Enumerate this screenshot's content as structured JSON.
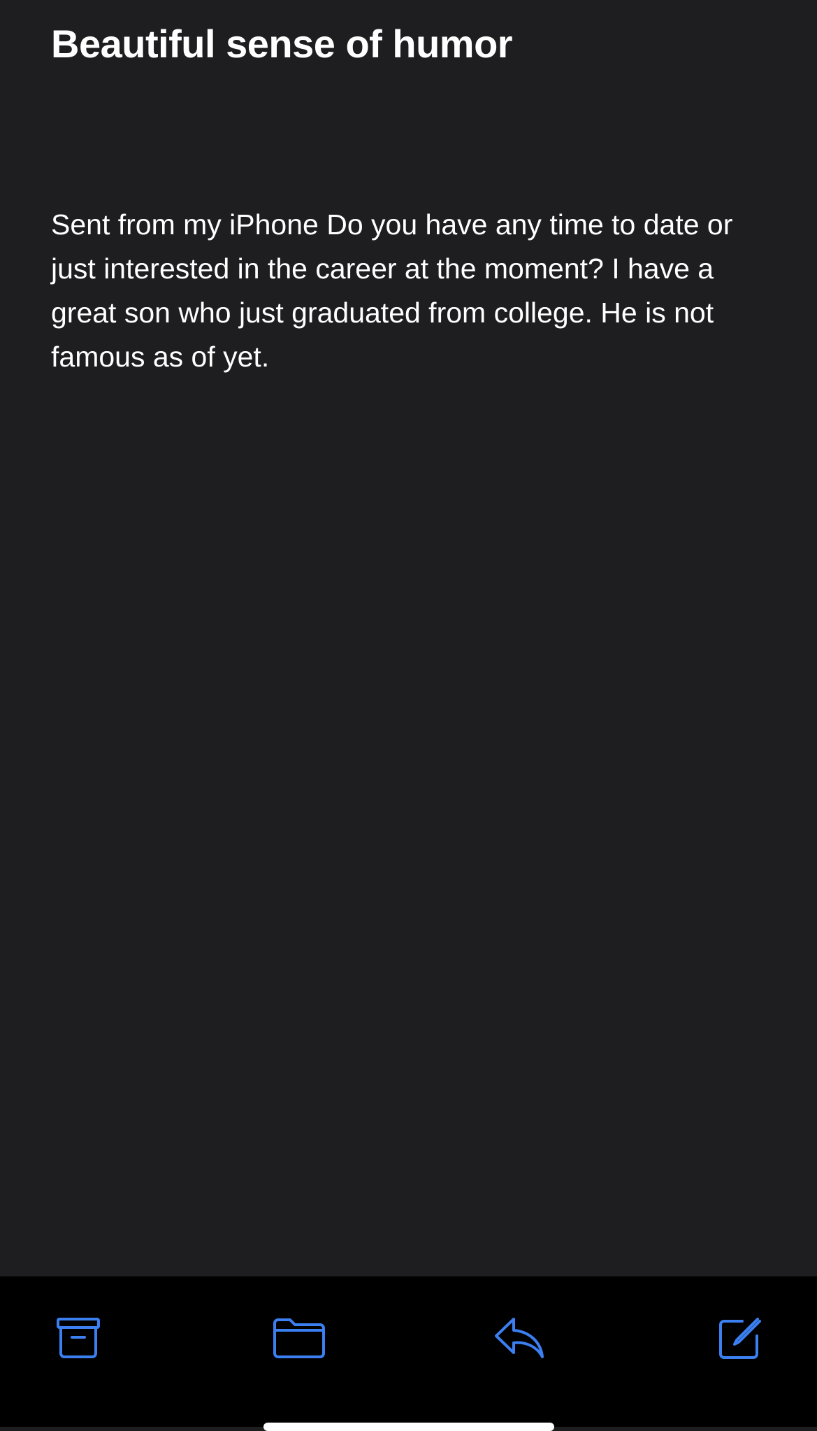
{
  "message": {
    "subject": "Beautiful sense of humor",
    "body": "Sent from my iPhone Do you have any time to date or just interested in the career at the moment? I have a great son who just graduated from college. He is not famous as of yet."
  },
  "toolbar": {
    "accent_color": "#3b7ff0",
    "items": [
      {
        "name": "archive",
        "icon": "archive-box-icon"
      },
      {
        "name": "move",
        "icon": "folder-icon"
      },
      {
        "name": "reply",
        "icon": "reply-arrow-icon"
      },
      {
        "name": "compose",
        "icon": "compose-icon"
      }
    ]
  }
}
